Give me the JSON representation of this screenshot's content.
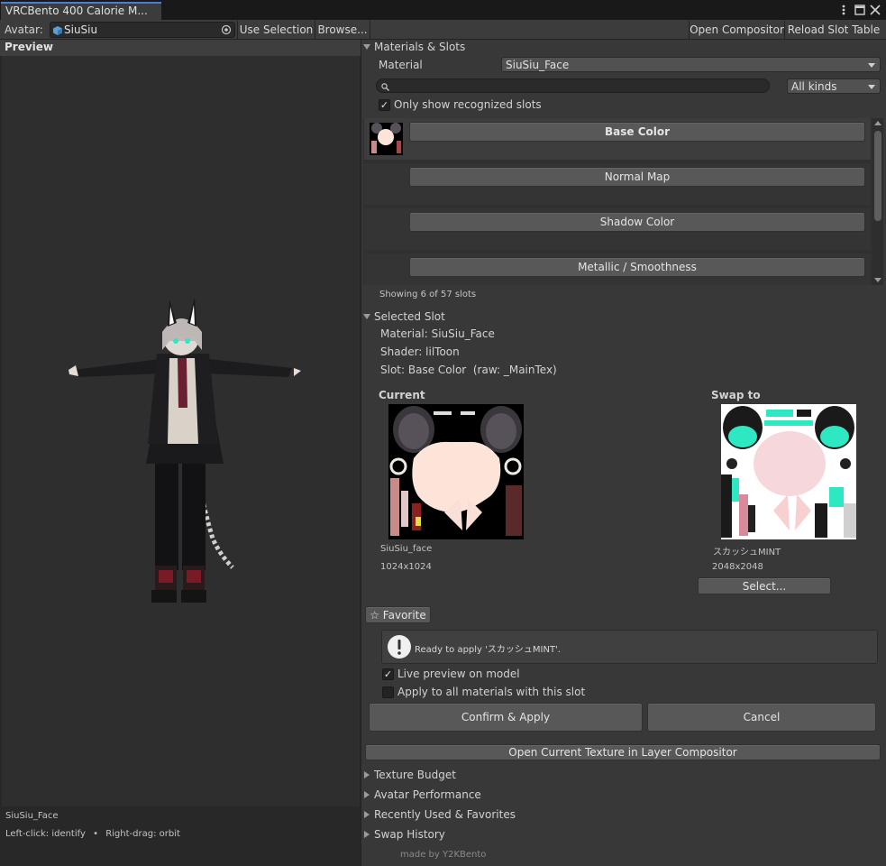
{
  "window": {
    "tab_title": "VRCBento 400 Calorie M...",
    "menu_icon": "kebab-icon",
    "maximize_icon": "maximize-icon",
    "close_icon": "close-icon"
  },
  "toolbar": {
    "avatar_label": "Avatar:",
    "avatar_value": "SiuSiu",
    "use_selection": "Use Selection",
    "browse": "Browse...",
    "open_compositor": "Open Compositor",
    "reload_slot_table": "Reload Slot Table"
  },
  "preview": {
    "header": "Preview",
    "object_name": "SiuSiu_Face",
    "hint_left": "Left-click: identify",
    "hint_sep": "•",
    "hint_right": "Right-drag: orbit"
  },
  "materials": {
    "section": "Materials & Slots",
    "material_label": "Material",
    "material_value": "SiuSiu_Face",
    "search_placeholder": "",
    "kind_filter": "All kinds",
    "only_recognized": "Only show recognized slots",
    "only_recognized_checked": true,
    "slots": [
      "Base Color",
      "Normal Map",
      "Shadow Color",
      "Metallic / Smoothness"
    ],
    "showing": "Showing 6 of 57 slots"
  },
  "selected": {
    "section": "Selected Slot",
    "material": "Material: SiuSiu_Face",
    "shader": "Shader: lilToon",
    "slot": "Slot: Base Color  (raw: _MainTex)",
    "current_label": "Current",
    "current_name": "SiuSiu_face",
    "current_size": "1024x1024",
    "swap_label": "Swap to",
    "swap_name": "スカッシュMINT",
    "swap_size": "2048x2048",
    "select_button": "Select...",
    "favorite": "☆ Favorite",
    "status": "Ready to apply 'スカッシュMINT'.",
    "live_preview": "Live preview on model",
    "live_preview_checked": true,
    "apply_all": "Apply to all materials with this slot",
    "apply_all_checked": false,
    "confirm": "Confirm & Apply",
    "cancel": "Cancel",
    "open_layer": "Open Current Texture in Layer Compositor"
  },
  "collapsed_sections": [
    "Texture Budget",
    "Avatar Performance",
    "Recently Used & Favorites",
    "Swap History"
  ],
  "footer": "made by Y2KBento",
  "colors": {
    "background": "#282828",
    "panel": "#383838",
    "button": "#585858",
    "accent_mint": "#2ee8c4"
  }
}
